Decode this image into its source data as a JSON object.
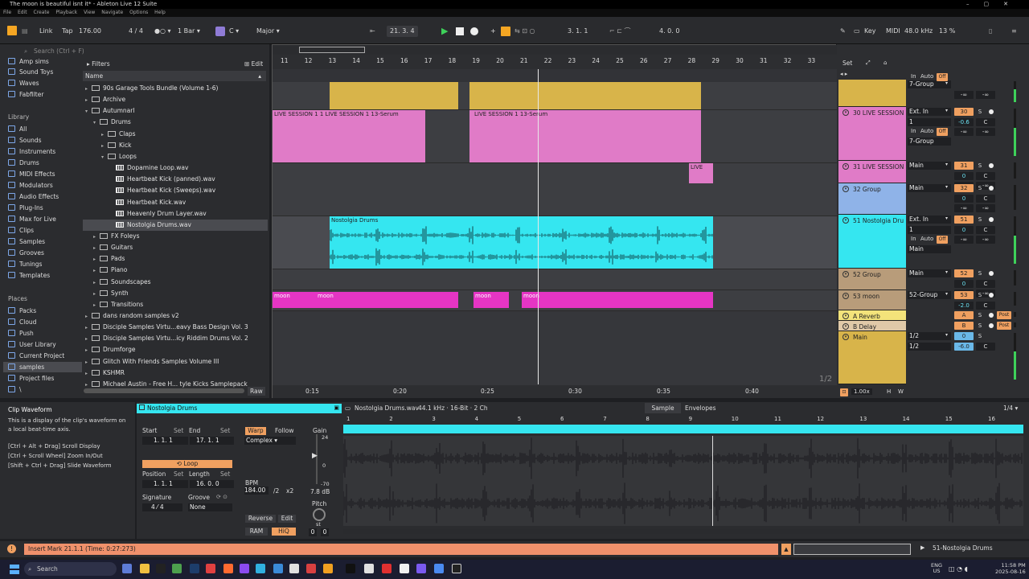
{
  "window": {
    "title": "The moon is beautiful isnt it* - Ableton Live 12 Suite"
  },
  "menu": [
    "File",
    "Edit",
    "Create",
    "Playback",
    "View",
    "Navigate",
    "Options",
    "Help"
  ],
  "transport": {
    "link": "Link",
    "tap": "Tap",
    "tempo": "176.00",
    "signature": "4 / 4",
    "quantize": "1 Bar",
    "key_root": "C",
    "scale": "Major",
    "position": "21.  3.  4",
    "loop_start": "3.  1.  1",
    "loop_length": "4.  0.  0",
    "key": "Key",
    "midi": "MIDI",
    "sample_rate": "48.0 kHz",
    "cpu": "13 %"
  },
  "browser": {
    "search_placeholder": "Search (Ctrl + F)",
    "filters": "Filters",
    "edit": "Edit",
    "name_header": "Name",
    "raw": "Raw",
    "top_items": [
      "Amp sims",
      "Sound Toys",
      "Waves",
      "Fabfilter"
    ],
    "library_header": "Library",
    "library": [
      "All",
      "Sounds",
      "Instruments",
      "Drums",
      "MIDI Effects",
      "Modulators",
      "Audio Effects",
      "Plug-Ins",
      "Max for Live",
      "Clips",
      "Samples",
      "Grooves",
      "Tunings",
      "Templates"
    ],
    "places_header": "Places",
    "places": [
      "Packs",
      "Cloud",
      "Push",
      "User Library",
      "Current Project",
      "samples",
      "Project files",
      "\\"
    ],
    "files": [
      {
        "name": "90s Garage Tools Bundle (Volume 1-6)",
        "indent": 0,
        "type": "folder",
        "open": false
      },
      {
        "name": "Archive",
        "indent": 0,
        "type": "folder",
        "open": false
      },
      {
        "name": "Autumnarl",
        "indent": 0,
        "type": "folder",
        "open": true
      },
      {
        "name": "Drums",
        "indent": 1,
        "type": "folder",
        "open": true
      },
      {
        "name": "Claps",
        "indent": 2,
        "type": "folder",
        "open": false
      },
      {
        "name": "Kick",
        "indent": 2,
        "type": "folder",
        "open": false
      },
      {
        "name": "Loops",
        "indent": 2,
        "type": "folder",
        "open": true
      },
      {
        "name": "Dopamine Loop.wav",
        "indent": 3,
        "type": "wav"
      },
      {
        "name": "Heartbeat Kick (panned).wav",
        "indent": 3,
        "type": "wav"
      },
      {
        "name": "Heartbeat Kick (Sweeps).wav",
        "indent": 3,
        "type": "wav"
      },
      {
        "name": "Heartbeat Kick.wav",
        "indent": 3,
        "type": "wav"
      },
      {
        "name": "Heavenly Drum Layer.wav",
        "indent": 3,
        "type": "wav"
      },
      {
        "name": "Nostolgia Drums.wav",
        "indent": 3,
        "type": "wav",
        "selected": true
      },
      {
        "name": "FX Foleys",
        "indent": 1,
        "type": "folder",
        "open": false
      },
      {
        "name": "Guitars",
        "indent": 1,
        "type": "folder",
        "open": false
      },
      {
        "name": "Pads",
        "indent": 1,
        "type": "folder",
        "open": false
      },
      {
        "name": "Piano",
        "indent": 1,
        "type": "folder",
        "open": false
      },
      {
        "name": "Soundscapes",
        "indent": 1,
        "type": "folder",
        "open": false
      },
      {
        "name": "Synth",
        "indent": 1,
        "type": "folder",
        "open": false
      },
      {
        "name": "Transitions",
        "indent": 1,
        "type": "folder",
        "open": false
      },
      {
        "name": "dans random samples v2",
        "indent": 0,
        "type": "folder",
        "open": false
      },
      {
        "name": "Disciple Samples Virtu...eavy Bass Design Vol. 3",
        "indent": 0,
        "type": "folder",
        "open": false
      },
      {
        "name": "Disciple Samples Virtu...icy Riddim Drums Vol. 2",
        "indent": 0,
        "type": "folder",
        "open": false
      },
      {
        "name": "Drumforge",
        "indent": 0,
        "type": "folder",
        "open": false
      },
      {
        "name": "Glitch With Friends Samples Volume III",
        "indent": 0,
        "type": "folder",
        "open": false
      },
      {
        "name": "KSHMR",
        "indent": 0,
        "type": "folder",
        "open": false
      },
      {
        "name": "Michael Austin - Free H... tyle Kicks Samplepack",
        "indent": 0,
        "type": "folder",
        "open": false
      }
    ]
  },
  "arrangement": {
    "bars": [
      "11",
      "12",
      "13",
      "14",
      "15",
      "16",
      "17",
      "18",
      "19",
      "20",
      "21",
      "22",
      "23",
      "24",
      "25",
      "26",
      "27",
      "28",
      "29",
      "30",
      "31",
      "32",
      "33"
    ],
    "times": [
      "0:15",
      "0:20",
      "0:25",
      "0:30",
      "0:35",
      "0:40"
    ],
    "page": "1/2",
    "clip_labels": {
      "live1": "LIVE SESSION 1 1 LIVE SESSION 1 13-Serum",
      "live2": "LIVE SESSION 1 13-Serum",
      "live3": "LIVE",
      "nostolgia": "Nostolgia Drums",
      "moon1": "moon",
      "moon2": "moon",
      "moon3": "moon",
      "moon4": "moon"
    }
  },
  "mixer": {
    "set": "Set",
    "tracks": [
      {
        "name": "",
        "color": "#d8b44a",
        "routing": "7-Group",
        "num": "",
        "vol": "-∞"
      },
      {
        "name": "30 LIVE SESSION",
        "color": "#e07bc7",
        "routing": "Ext. In",
        "num": "30",
        "vol": "-0.6",
        "routing2": "7-Group"
      },
      {
        "name": "31 LIVE SESSION",
        "color": "#e07bc7",
        "routing": "Main",
        "num": "31",
        "vol": "0"
      },
      {
        "name": "32 Group",
        "color": "#8fb3e8",
        "routing": "Main",
        "num": "32",
        "vol": "0"
      },
      {
        "name": "51 Nostolgia Dru",
        "color": "#35e6f0",
        "routing": "Ext. In",
        "num": "51",
        "vol": "0",
        "routing2": "Main"
      },
      {
        "name": "52 Group",
        "color": "#b89c7a",
        "routing": "Main",
        "num": "52",
        "vol": "0"
      },
      {
        "name": "53 moon",
        "color": "#b89c7a",
        "routing": "52-Group",
        "num": "53",
        "vol": "-2.0"
      },
      {
        "name": "A Reverb",
        "color": "#f3e37a",
        "routing": "",
        "num": "A",
        "vol": ""
      },
      {
        "name": "B Delay",
        "color": "#e0c9a8",
        "routing": "",
        "num": "B",
        "vol": ""
      },
      {
        "name": "Main",
        "color": "#d8b44a",
        "routing": "1/2",
        "num": "0",
        "vol": "-6.0",
        "routing2": "1/2"
      }
    ],
    "labels": {
      "in": "In",
      "auto": "Auto",
      "off": "Off",
      "one": "1",
      "s": "S",
      "c": "C",
      "post": "Post",
      "zoom": "1.00x",
      "h": "H",
      "w": "W",
      "neg_inf": "-∞"
    }
  },
  "info": {
    "title": "Clip Waveform",
    "body": "This is a display of the clip's waveform on a local beat-time axis.",
    "tips": [
      "[Ctrl + Alt + Drag] Scroll Display",
      "[Ctrl + Scroll Wheel] Zoom In/Out",
      "[Shift + Ctrl + Drag] Slide Waveform"
    ]
  },
  "clip": {
    "name": "Nostolgia Drums",
    "start": "Start",
    "set": "Set",
    "end": "End",
    "start_val": "1.   1.   1",
    "end_val": "17.   1.   1",
    "loop": "Loop",
    "position": "Position",
    "length": "Length",
    "position_val": "1.   1.   1",
    "length_val": "16.   0.   0",
    "signature": "Signature",
    "groove": "Groove",
    "sig_num": "4",
    "sig_den": "4",
    "groove_val": "None",
    "warp": "Warp",
    "follow": "Follow",
    "mode": "Complex",
    "bpm_label": "BPM",
    "bpm": "184.00",
    "half": "/2",
    "double": "x2",
    "gain": "Gain",
    "gain_top": "24",
    "gain_mid": "0",
    "gain_low": "-70",
    "gain_db": "7.8 dB",
    "pitch": "Pitch",
    "st": "st",
    "pitch_st": "0",
    "pitch_ct": "0",
    "reverse": "Reverse",
    "edit": "Edit",
    "ram": "RAM",
    "hiq": "HiQ"
  },
  "sample": {
    "file": "Nostolgia Drums.wav",
    "specs": "44.1 kHz · 16-Bit · 2 Ch",
    "tab_sample": "Sample",
    "tab_envelopes": "Envelopes",
    "quant": "1/4",
    "ruler": [
      "1",
      "2",
      "3",
      "4",
      "5",
      "6",
      "7",
      "8",
      "9",
      "10",
      "11",
      "12",
      "13",
      "14",
      "15",
      "16"
    ]
  },
  "status": {
    "message": "Insert Mark 21.1.1 (Time: 0:27:273)",
    "track": "51-Nostolgia Drums"
  },
  "taskbar": {
    "search": "Search",
    "lang": "ENG",
    "region": "US",
    "time": "11:58 PM",
    "date": "2025-08-16"
  },
  "colors": {
    "yellow": "#d8b44a",
    "pink": "#e07bc7",
    "cyan": "#35e6f0",
    "magenta": "#e535c4",
    "status_orange": "#f0916b"
  }
}
